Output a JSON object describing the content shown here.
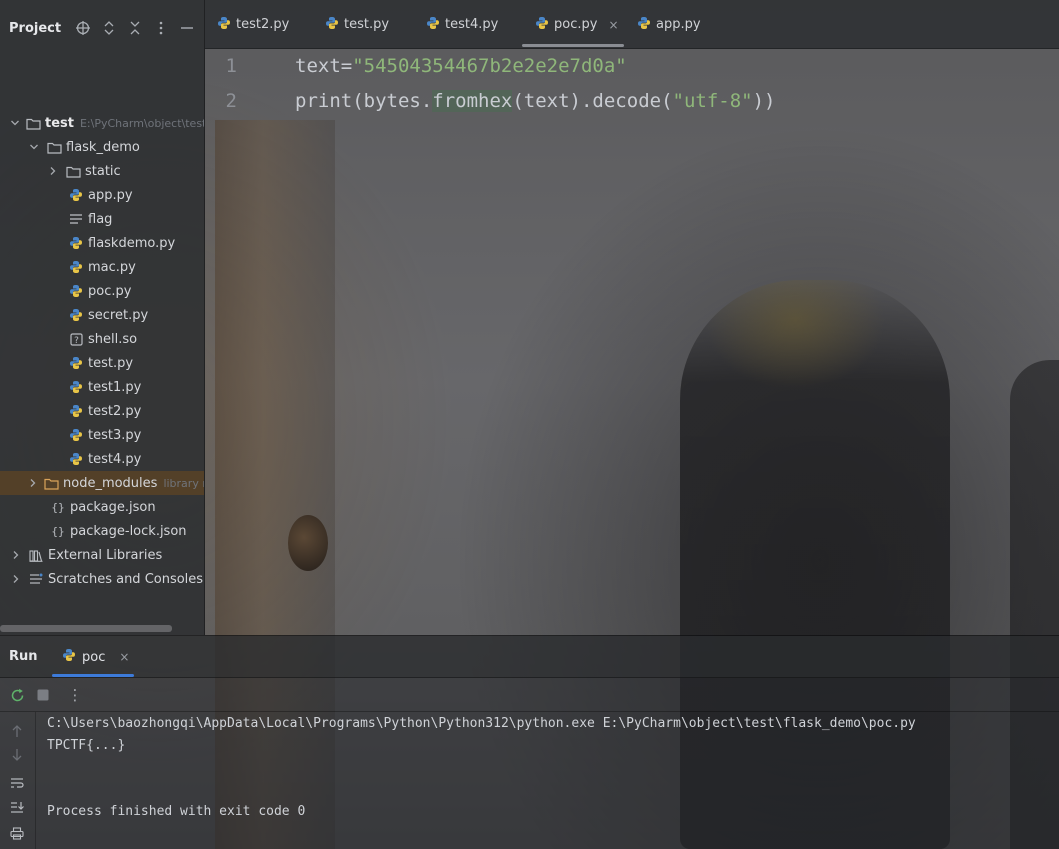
{
  "project_panel": {
    "title": "Project",
    "tree": [
      {
        "label": "test",
        "hint": "E:\\PyCharm\\object\\test",
        "kind": "folder",
        "depth": 0,
        "expanded": true
      },
      {
        "label": "flask_demo",
        "kind": "folder",
        "depth": 1,
        "expanded": true
      },
      {
        "label": "static",
        "kind": "folder",
        "depth": 2,
        "expanded": false
      },
      {
        "label": "app.py",
        "kind": "python",
        "depth": 2
      },
      {
        "label": "flag",
        "kind": "text",
        "depth": 2
      },
      {
        "label": "flaskdemo.py",
        "kind": "python",
        "depth": 2
      },
      {
        "label": "mac.py",
        "kind": "python",
        "depth": 2
      },
      {
        "label": "poc.py",
        "kind": "python",
        "depth": 2
      },
      {
        "label": "secret.py",
        "kind": "python",
        "depth": 2
      },
      {
        "label": "shell.so",
        "kind": "unknown",
        "depth": 2
      },
      {
        "label": "test.py",
        "kind": "python",
        "depth": 2
      },
      {
        "label": "test1.py",
        "kind": "python",
        "depth": 2
      },
      {
        "label": "test2.py",
        "kind": "python",
        "depth": 2
      },
      {
        "label": "test3.py",
        "kind": "python",
        "depth": 2
      },
      {
        "label": "test4.py",
        "kind": "python",
        "depth": 2
      },
      {
        "label": "node_modules",
        "hint": "library root",
        "kind": "folder-lib",
        "depth": 1,
        "expanded": false
      },
      {
        "label": "package.json",
        "kind": "json",
        "depth": 1
      },
      {
        "label": "package-lock.json",
        "kind": "json",
        "depth": 1
      },
      {
        "label": "External Libraries",
        "kind": "libraries",
        "depth": 0,
        "expanded": false
      },
      {
        "label": "Scratches and Consoles",
        "kind": "scratches",
        "depth": 0,
        "expanded": false
      }
    ]
  },
  "editor": {
    "tabs": [
      {
        "label": "test2.py",
        "active": false
      },
      {
        "label": "test.py",
        "active": false
      },
      {
        "label": "test4.py",
        "active": false
      },
      {
        "label": "poc.py",
        "active": true,
        "close": "×"
      },
      {
        "label": "app.py",
        "active": false
      }
    ],
    "gutter": [
      "1",
      "2"
    ],
    "code": {
      "line1_var": "text=",
      "line1_str": "\"54504354467b2e2e2e7d0a\"",
      "line2_a": "print(bytes.",
      "line2_hl": "fromhex",
      "line2_b": "(text).decode(",
      "line2_str": "\"utf-8\"",
      "line2_c": "))"
    }
  },
  "run_panel": {
    "title": "Run",
    "tab_label": "poc",
    "tab_close": "×",
    "toolbar_more": "⋮",
    "console": {
      "command": "C:\\Users\\baozhongqi\\AppData\\Local\\Programs\\Python\\Python312\\python.exe E:\\PyCharm\\object\\test\\flask_demo\\poc.py",
      "output": "TPCTF{...}",
      "exit": "Process finished with exit code 0"
    }
  },
  "colors": {
    "string_green": "#8fb77a",
    "python_blue": "#4a86c8",
    "python_yellow": "#e8c547",
    "run_tab_accent": "#3d7bd9",
    "selected_row": "#6e481e"
  }
}
